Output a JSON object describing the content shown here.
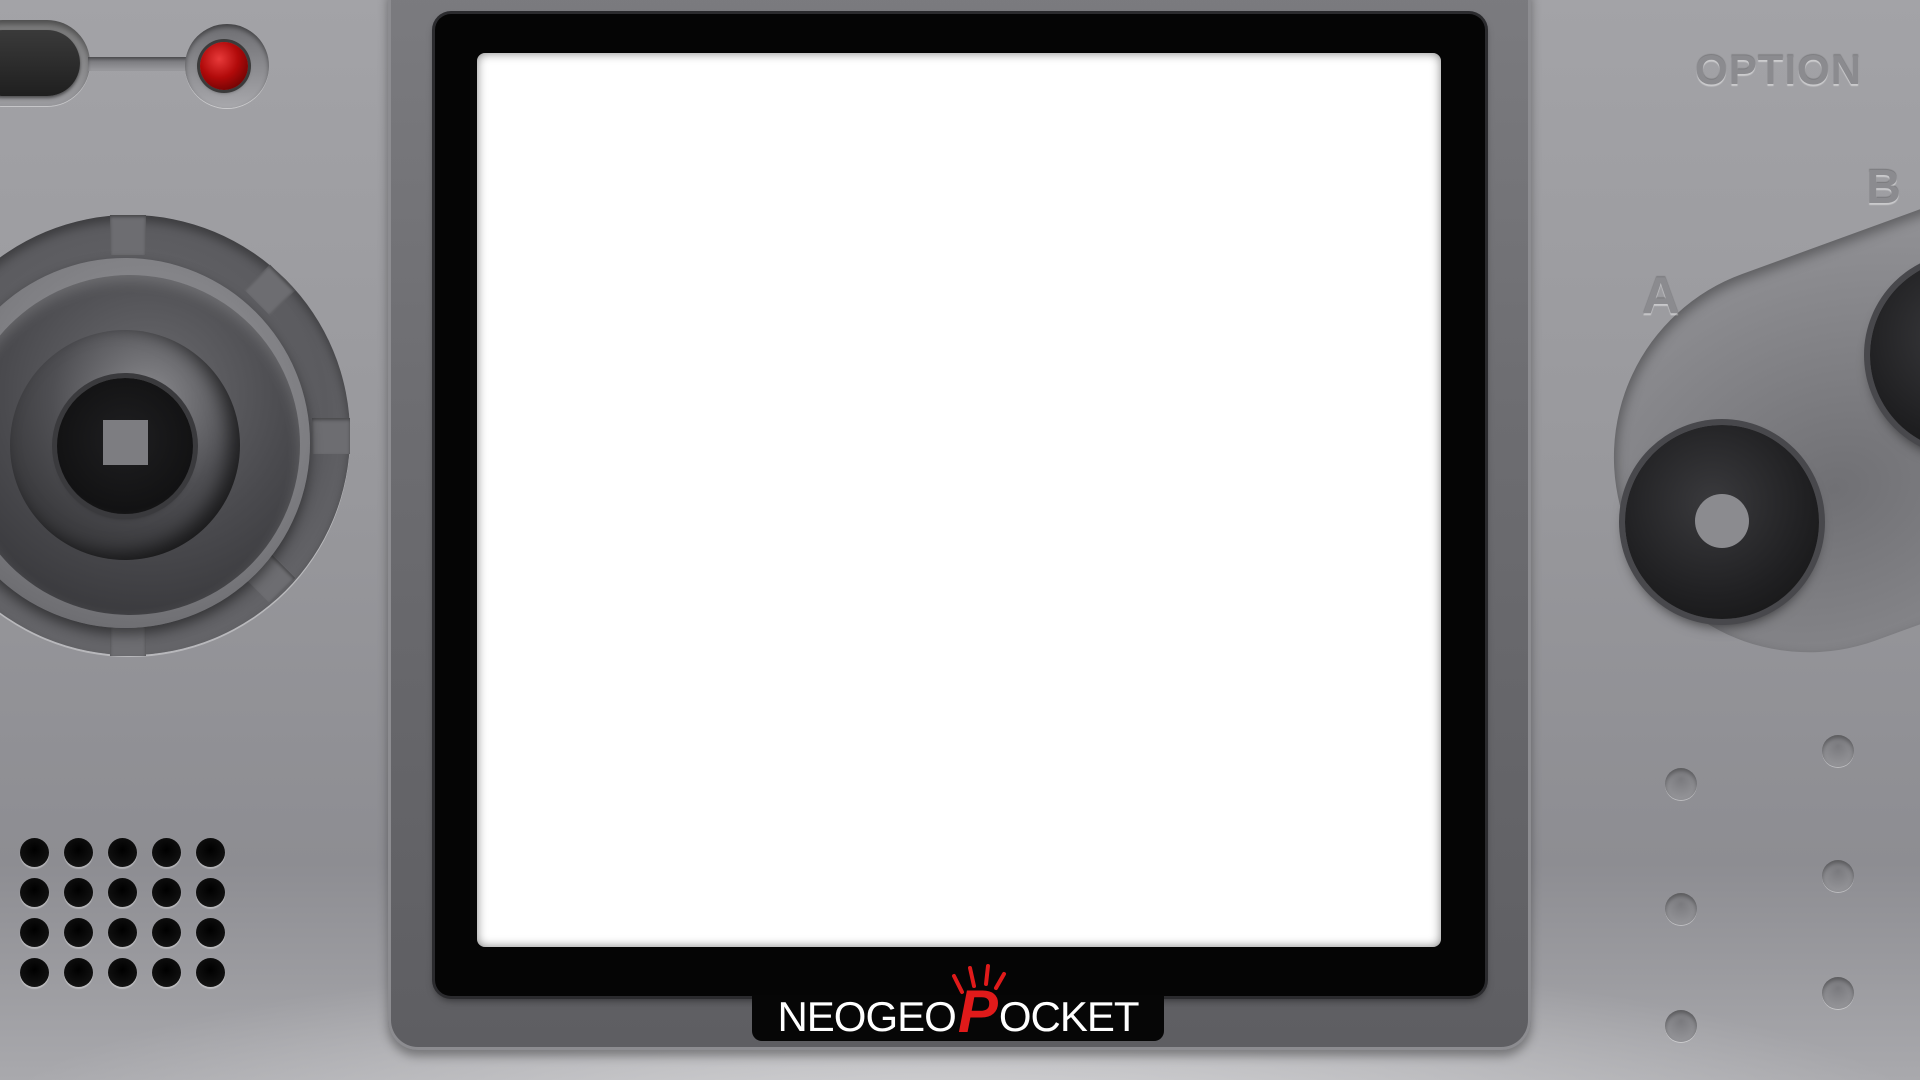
{
  "console": {
    "logo_prefix": "NEOGEO",
    "logo_p": "P",
    "logo_suffix": "OCKET",
    "brand_accent": "#e01a1a",
    "screen_color": "#ffffff"
  },
  "controls": {
    "option_label": "OPTION",
    "button_a_label": "A",
    "button_b_label": "B",
    "power_led_color": "#b10a0a"
  },
  "icons": {
    "power_switch": "power-switch-icon",
    "joystick": "joystick-icon",
    "speaker": "speaker-grille-icon"
  }
}
